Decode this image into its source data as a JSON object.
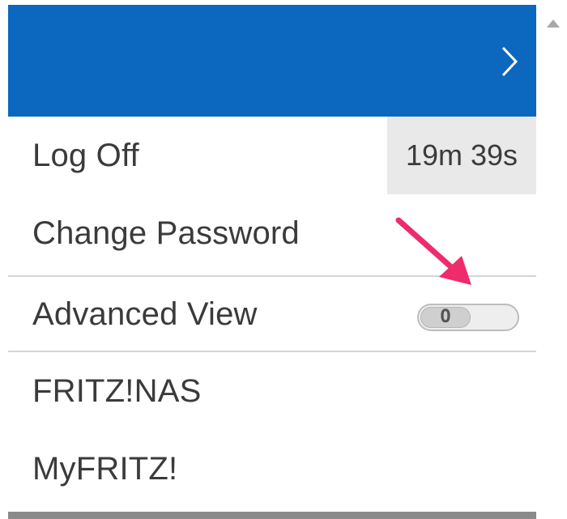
{
  "colors": {
    "header_blue": "#0b68be",
    "timer_bg": "#e9e9e9",
    "annotation_arrow": "#ee2b6b",
    "text": "#3b3b3b"
  },
  "header": {
    "chevron_icon": "chevron-right-icon"
  },
  "menu": {
    "log_off": {
      "label": "Log Off",
      "timer": "19m 39s"
    },
    "change_password": {
      "label": "Change Password"
    },
    "advanced_view": {
      "label": "Advanced View",
      "toggle_state": "O",
      "enabled": false
    },
    "fritz_nas": {
      "label": "FRITZ!NAS"
    },
    "myfritz": {
      "label": "MyFRITZ!"
    }
  },
  "scrollbar": {
    "up_icon": "scroll-up-arrow-icon"
  },
  "annotation": {
    "icon": "pointer-arrow-icon"
  }
}
